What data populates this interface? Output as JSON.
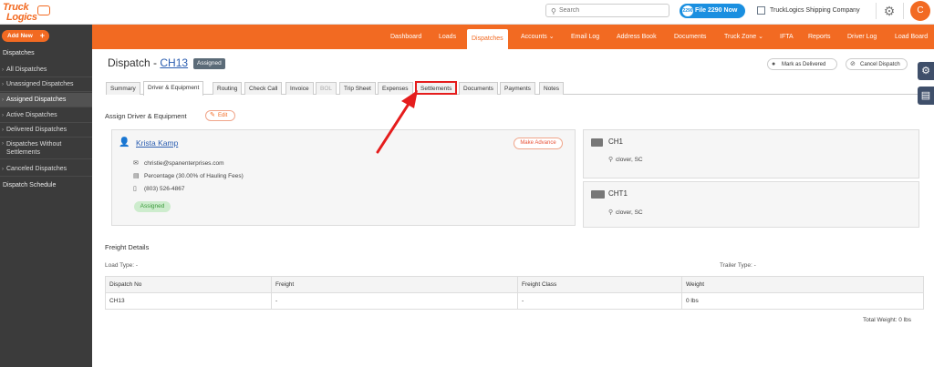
{
  "logo": {
    "line1": "Truck",
    "line2": "Logics"
  },
  "search": {
    "placeholder": "Search"
  },
  "header": {
    "file_button": "File 2290 Now",
    "file_badge": "2290",
    "company": "TruckLogics Shipping Company",
    "avatar_letter": "C"
  },
  "sidebar": {
    "add_new": "Add New",
    "section": "Dispatches",
    "items": [
      {
        "label": "All Dispatches"
      },
      {
        "label": "Unassigned Dispatches"
      },
      {
        "label": "Assigned Dispatches"
      },
      {
        "label": "Active Dispatches"
      },
      {
        "label": "Delivered Dispatches"
      },
      {
        "label": "Dispatches Without Settlements"
      },
      {
        "label": "Canceled Dispatches"
      }
    ],
    "schedule": "Dispatch Schedule"
  },
  "nav": {
    "items": [
      {
        "label": "Dashboard"
      },
      {
        "label": "Loads"
      },
      {
        "label": "Dispatches"
      },
      {
        "label": "Accounts ⌄"
      },
      {
        "label": "Email Log"
      },
      {
        "label": "Address Book"
      },
      {
        "label": "Documents"
      },
      {
        "label": "Truck Zone ⌄"
      },
      {
        "label": "IFTA"
      },
      {
        "label": "Reports"
      },
      {
        "label": "Driver Log"
      },
      {
        "label": "Load Board"
      }
    ]
  },
  "page": {
    "title_prefix": "Dispatch -",
    "dispatch_id": "CH13",
    "status_badge": "Assigned",
    "mark_delivered": "Mark as Delivered",
    "cancel_dispatch": "Cancel Dispatch"
  },
  "tabs": [
    {
      "label": "Summary"
    },
    {
      "label": "Driver & Equipment"
    },
    {
      "label": "Routing"
    },
    {
      "label": "Check Call"
    },
    {
      "label": "Invoice"
    },
    {
      "label": "BOL"
    },
    {
      "label": "Trip Sheet"
    },
    {
      "label": "Expenses"
    },
    {
      "label": "Settlements"
    },
    {
      "label": "Documents"
    },
    {
      "label": "Payments"
    },
    {
      "label": "Notes"
    }
  ],
  "assign": {
    "title": "Assign Driver & Equipment",
    "edit": "Edit",
    "driver": {
      "name": "Krista Kamp",
      "make_advance": "Make Advance",
      "email": "christie@spanenterprises.com",
      "pay": "Percentage (30.00% of Hauling Fees)",
      "phone": "(803) 526-4867",
      "status": "Assigned"
    },
    "equipment": [
      {
        "name": "CH1",
        "location": "clover, SC"
      },
      {
        "name": "CHT1",
        "location": "clover, SC"
      }
    ]
  },
  "freight": {
    "title": "Freight Details",
    "load_type": "Load Type: -",
    "trailer_type": "Trailer Type: -",
    "columns": [
      "Dispatch No",
      "Freight",
      "Freight Class",
      "Weight"
    ],
    "row": [
      "CH13",
      "-",
      "-",
      "0 lbs"
    ],
    "total": "Total Weight:  0 lbs"
  },
  "colors": {
    "brand": "#f26a22",
    "link": "#2a5db0",
    "highlight": "#e51d1d"
  }
}
